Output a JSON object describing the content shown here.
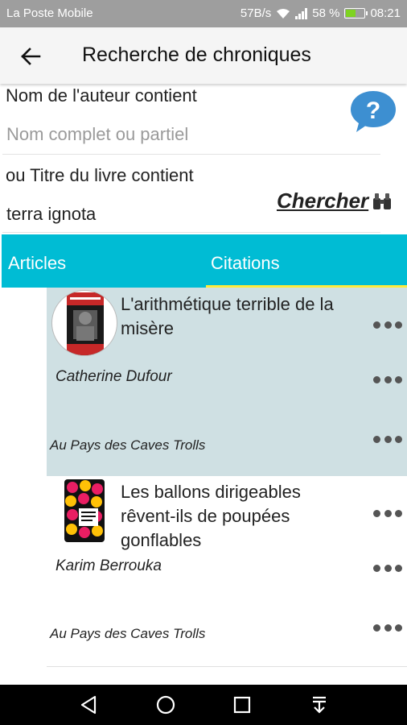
{
  "status_bar": {
    "carrier": "La Poste Mobile",
    "speed": "57B/s",
    "battery_percent": "58 %",
    "time": "08:21",
    "battery_level": 0.58,
    "battery_color": "#7ed321"
  },
  "app_bar": {
    "back_icon": "arrow-left-icon",
    "title": "Recherche  de chroniques"
  },
  "search": {
    "author_label": "Nom de l'auteur contient",
    "author_placeholder": "Nom complet ou partiel",
    "author_value": "",
    "title_label": "ou Titre du livre contient",
    "title_value": "terra ignota",
    "help_icon": "question-bubble-icon",
    "search_button": "Chercher",
    "search_icon": "binoculars-icon"
  },
  "tabs": {
    "items": [
      {
        "label": "Articles",
        "selected": false
      },
      {
        "label": "Citations",
        "selected": true
      }
    ],
    "bar_color": "#00bcd4",
    "indicator_color": "#ffeb3b"
  },
  "results": [
    {
      "title": "L'arithmétique terrible de la misère",
      "author": "Catherine Dufour",
      "blog": "Au Pays des Caves Trolls",
      "selected": true
    },
    {
      "title": "Les ballons dirigeables rêvent-ils de poupées gonflables",
      "author": "Karim Berrouka",
      "blog": "Au Pays des Caves Trolls",
      "selected": false
    }
  ],
  "selected_row_color": "#cfe0e3",
  "nav_bar": [
    "back-triangle-icon",
    "home-circle-icon",
    "recents-square-icon",
    "notifications-down-icon"
  ]
}
